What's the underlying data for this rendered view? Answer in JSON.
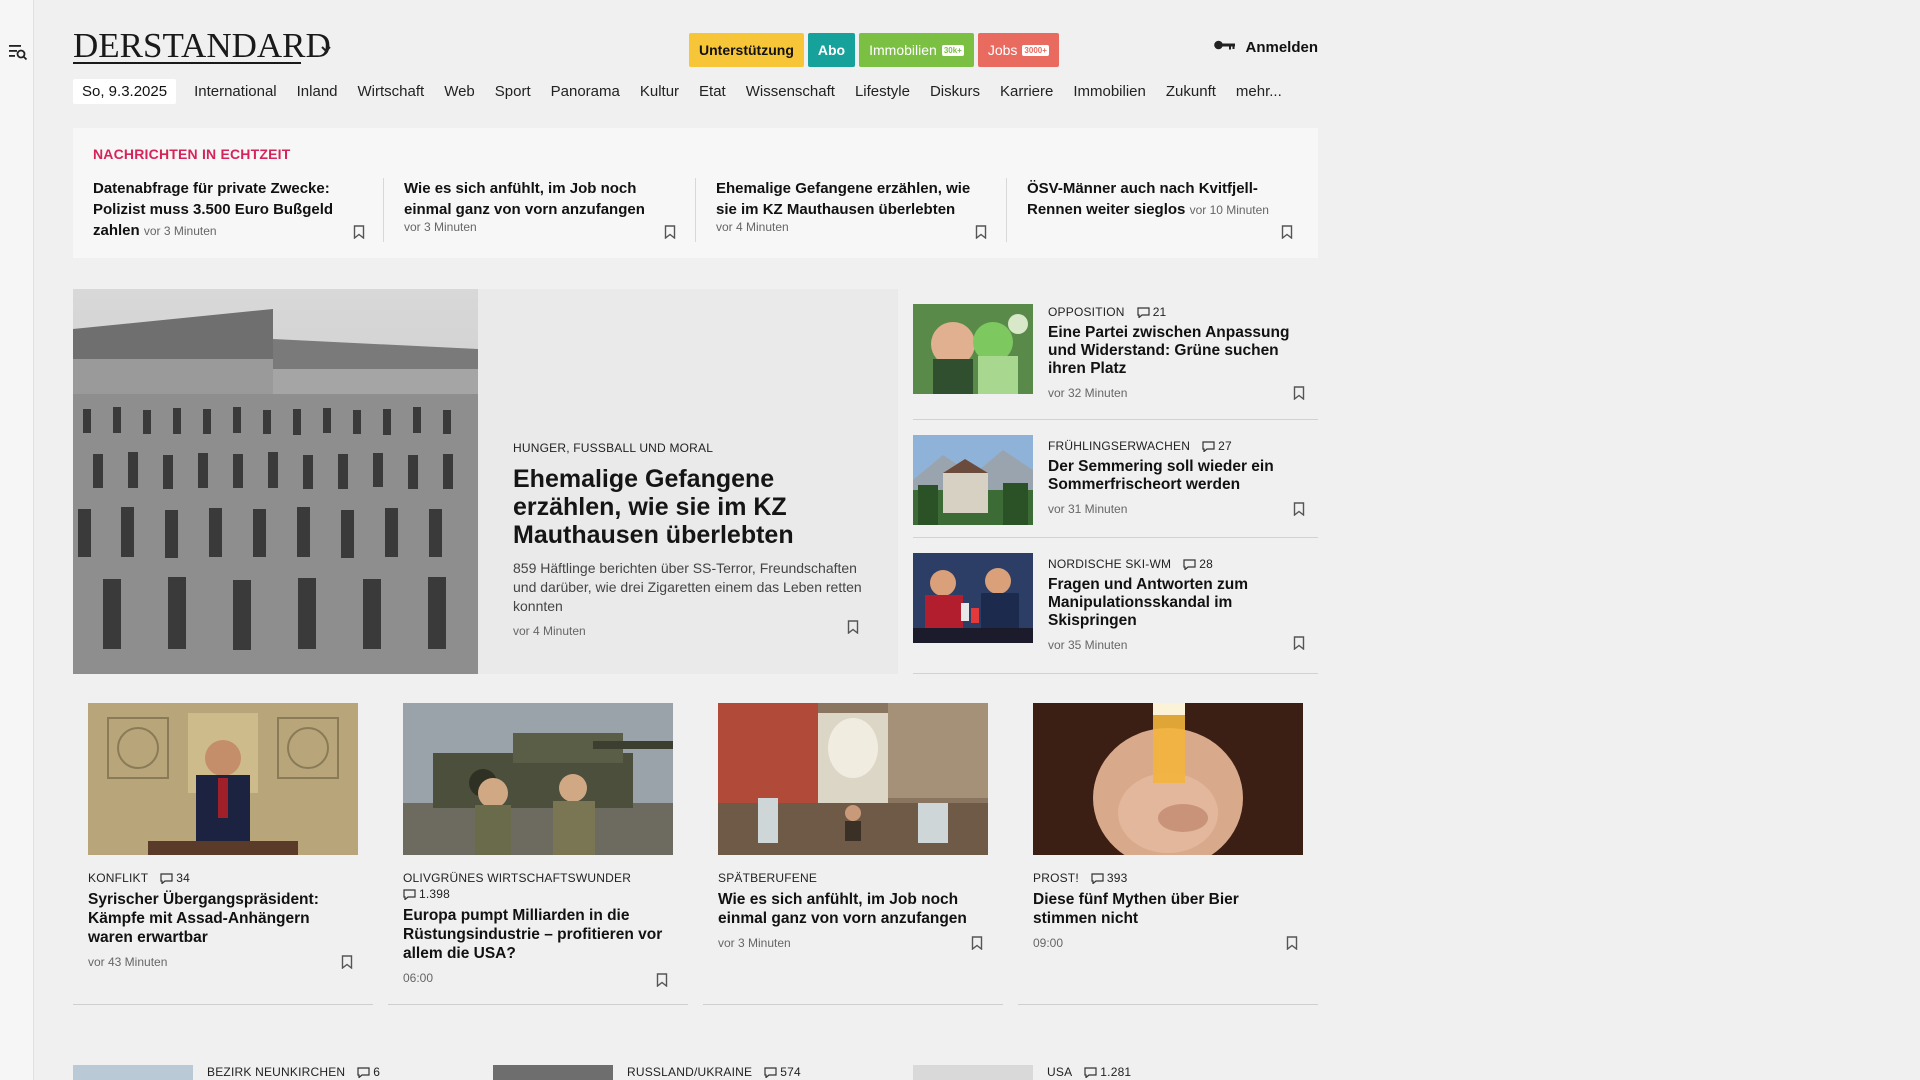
{
  "colors": {
    "accent_red": "#d6245a",
    "support": "#f6c638",
    "abo": "#16a29b",
    "immobilien": "#7bc043",
    "jobs": "#e96b5f"
  },
  "header": {
    "logo": "DERSTANDARD",
    "promos": {
      "support": "Unterstützung",
      "abo": "Abo",
      "immobilien": "Immobilien",
      "immobilien_tag": "30k+",
      "jobs": "Jobs",
      "jobs_tag": "3000+"
    },
    "login": "Anmelden"
  },
  "nav": {
    "date": "So, 9.3.2025",
    "items": [
      "International",
      "Inland",
      "Wirtschaft",
      "Web",
      "Sport",
      "Panorama",
      "Kultur",
      "Etat",
      "Wissenschaft",
      "Lifestyle",
      "Diskurs",
      "Karriere",
      "Immobilien",
      "Zukunft",
      "mehr..."
    ]
  },
  "ticker": {
    "title": "NACHRICHTEN IN ECHTZEIT",
    "items": [
      {
        "title": "Datenabfrage für private Zwecke: Polizist muss 3.500 Euro Bußgeld zahlen",
        "time": "vor 3 Minuten"
      },
      {
        "title": "Wie es sich anfühlt, im Job noch einmal ganz von vorn anzufangen",
        "time": "vor 3 Minuten"
      },
      {
        "title": "Ehemalige Gefangene erzählen, wie sie im KZ Mauthausen überlebten",
        "time": "vor 4 Minuten"
      },
      {
        "title": "ÖSV-Männer auch nach Kvitfjell-Rennen weiter sieglos",
        "time": "vor 10 Minuten"
      }
    ]
  },
  "lead": {
    "kicker": "HUNGER, FUSSBALL UND MORAL",
    "headline": "Ehemalige Gefangene erzählen, wie sie im KZ Mauthausen überlebten",
    "teaser": "859 Häftlinge berichten über SS-Terror, Freundschaften und darüber, wie drei Zigaretten einem das Leben retten konnten",
    "time": "vor 4 Minuten"
  },
  "side": [
    {
      "kicker": "OPPOSITION",
      "comments": "21",
      "headline": "Eine Partei zwischen Anpassung und Widerstand: Grüne suchen ihren Platz",
      "time": "vor 32 Minuten"
    },
    {
      "kicker": "FRÜHLINGSERWACHEN",
      "comments": "27",
      "headline": "Der Semmering soll wieder ein Sommerfrischeort werden",
      "time": "vor 31 Minuten"
    },
    {
      "kicker": "NORDISCHE SKI-WM",
      "comments": "28",
      "headline": "Fragen und Antworten zum Manipulationsskandal im Skispringen",
      "time": "vor 35 Minuten"
    }
  ],
  "cards": [
    {
      "kicker": "KONFLIKT",
      "comments": "34",
      "headline": "Syrischer Übergangspräsident: Kämpfe mit Assad-Anhängern waren erwartbar",
      "time": "vor 43 Minuten"
    },
    {
      "kicker": "OLIVGRÜNES WIRTSCHAFTSWUNDER",
      "comments": "1.398",
      "headline": "Europa pumpt Milliarden in die Rüstungsindustrie – profitieren vor allem die USA?",
      "time": "06:00"
    },
    {
      "kicker": "SPÄTBERUFENE",
      "comments": "",
      "headline": "Wie es sich anfühlt, im Job noch einmal ganz von vorn anzufangen",
      "time": "vor 3 Minuten"
    },
    {
      "kicker": "PROST!",
      "comments": "393",
      "headline": "Diese fünf Mythen über Bier stimmen nicht",
      "time": "09:00"
    }
  ],
  "bottom": [
    {
      "kicker": "BEZIRK NEUNKIRCHEN",
      "comments": "6"
    },
    {
      "kicker": "RUSSLAND/UKRAINE",
      "comments": "574"
    },
    {
      "kicker": "USA",
      "comments": "1.281"
    }
  ]
}
